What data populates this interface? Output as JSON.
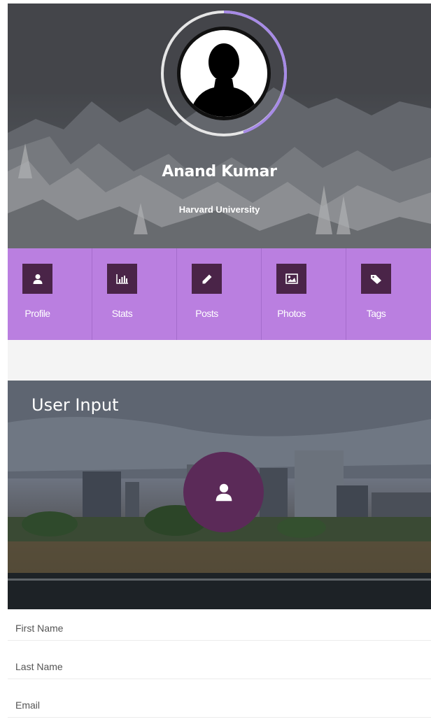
{
  "profile": {
    "name": "Anand Kumar",
    "school": "Harvard University",
    "ring_color": "#a78be6"
  },
  "nav": {
    "accent": "#ba7fe0",
    "items": [
      {
        "label": "Profile",
        "icon": "user-icon"
      },
      {
        "label": "Stats",
        "icon": "bar-chart-icon"
      },
      {
        "label": "Posts",
        "icon": "pencil-icon"
      },
      {
        "label": "Photos",
        "icon": "image-icon"
      },
      {
        "label": "Tags",
        "icon": "tag-icon"
      }
    ]
  },
  "card": {
    "title": "User Input",
    "fab_icon": "user-icon",
    "fab_color": "#5b2a58"
  },
  "form": {
    "fields": [
      {
        "placeholder": "First Name"
      },
      {
        "placeholder": "Last Name"
      },
      {
        "placeholder": "Email"
      }
    ]
  }
}
